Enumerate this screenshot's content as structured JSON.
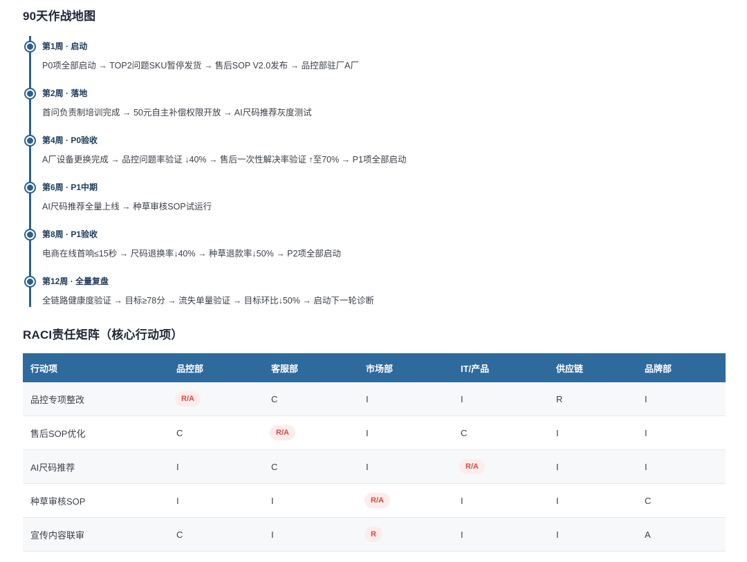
{
  "roadmap": {
    "title": "90天作战地图",
    "items": [
      {
        "head": "第1周 · 启动",
        "desc": "P0项全部启动 → TOP2问题SKU暂停发货 → 售后SOP V2.0发布 → 品控部驻厂A厂"
      },
      {
        "head": "第2周 · 落地",
        "desc": "首问负责制培训完成 → 50元自主补偿权限开放 → AI尺码推荐灰度测试"
      },
      {
        "head": "第4周 · P0验收",
        "desc": "A厂设备更换完成 → 品控问题率验证 ↓40% → 售后一次性解决率验证 ↑至70% → P1项全部启动"
      },
      {
        "head": "第6周 · P1中期",
        "desc": "AI尺码推荐全量上线 → 种草审核SOP试运行"
      },
      {
        "head": "第8周 · P1验收",
        "desc": "电商在线首响≤15秒 → 尺码退换率↓40% → 种草退款率↓50% → P2项全部启动"
      },
      {
        "head": "第12周 · 全量复盘",
        "desc": "全链路健康度验证 → 目标≥78分 → 流失单量验证 → 目标环比↓50% → 启动下一轮诊断"
      }
    ]
  },
  "raci": {
    "title": "RACI责任矩阵（核心行动项）",
    "columns": [
      "行动项",
      "品控部",
      "客服部",
      "市场部",
      "IT/产品",
      "供应链",
      "品牌部"
    ],
    "rows": [
      [
        "品控专项整改",
        "R/A",
        "C",
        "I",
        "I",
        "R",
        "I"
      ],
      [
        "售后SOP优化",
        "C",
        "R/A",
        "I",
        "C",
        "I",
        "I"
      ],
      [
        "AI尺码推荐",
        "I",
        "C",
        "I",
        "R/A",
        "I",
        "I"
      ],
      [
        "种草审核SOP",
        "I",
        "I",
        "R/A",
        "I",
        "I",
        "C"
      ],
      [
        "宣传内容联审",
        "C",
        "I",
        "R",
        "I",
        "I",
        "A"
      ]
    ],
    "highlight_cells": [
      [
        0,
        1
      ],
      [
        1,
        2
      ],
      [
        2,
        4
      ],
      [
        3,
        3
      ],
      [
        4,
        3
      ]
    ],
    "colors": {
      "header_bg": "#2f6a9c",
      "badge_bg": "#fdecec",
      "badge_text": "#e0473c",
      "timeline": "#2b5f8f"
    }
  }
}
